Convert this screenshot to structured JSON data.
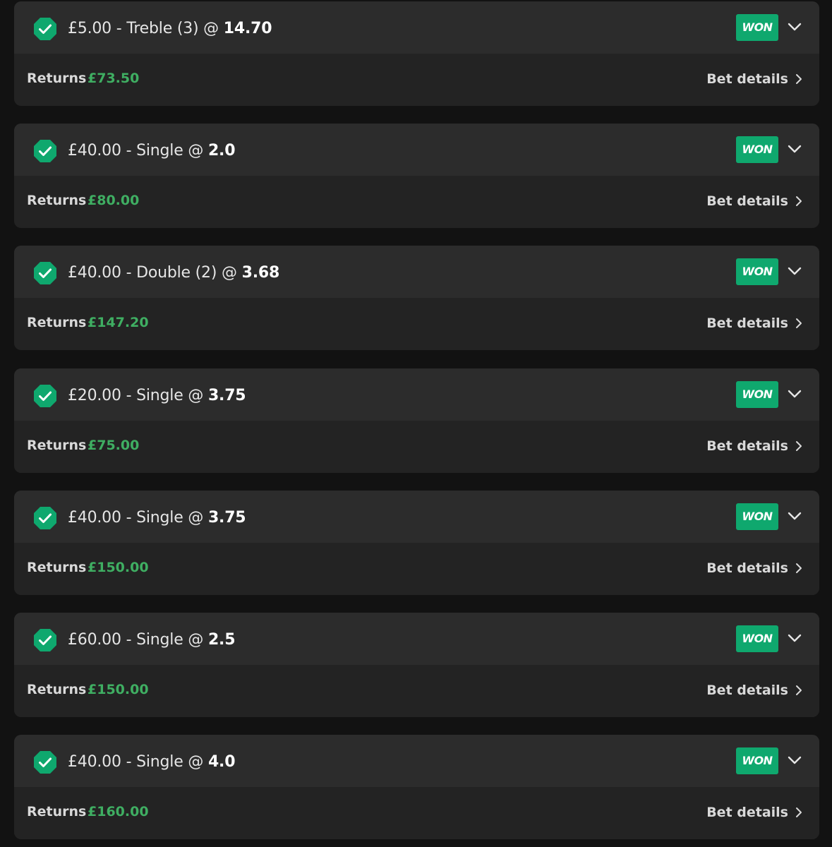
{
  "colors": {
    "page_background": "#121212",
    "card_header": "#2c2c2c",
    "card_footer": "#232323",
    "accent_green": "#0fa86e",
    "returns_green": "#3fae62"
  },
  "icons": {
    "status": "check-icon",
    "expand": "chevron-down-icon",
    "details": "chevron-right-icon"
  },
  "labels": {
    "returns": "Returns",
    "bet_details": "Bet details",
    "separator": " - ",
    "at": " @ "
  },
  "bets": [
    {
      "stake": "£5.00",
      "type": "Treble (3)",
      "odds": "14.70",
      "status": "WON",
      "returns": "£73.50"
    },
    {
      "stake": "£40.00",
      "type": "Single",
      "odds": "2.0",
      "status": "WON",
      "returns": "£80.00"
    },
    {
      "stake": "£40.00",
      "type": "Double (2)",
      "odds": "3.68",
      "status": "WON",
      "returns": "£147.20"
    },
    {
      "stake": "£20.00",
      "type": "Single",
      "odds": "3.75",
      "status": "WON",
      "returns": "£75.00"
    },
    {
      "stake": "£40.00",
      "type": "Single",
      "odds": "3.75",
      "status": "WON",
      "returns": "£150.00"
    },
    {
      "stake": "£60.00",
      "type": "Single",
      "odds": "2.5",
      "status": "WON",
      "returns": "£150.00"
    },
    {
      "stake": "£40.00",
      "type": "Single",
      "odds": "4.0",
      "status": "WON",
      "returns": "£160.00"
    }
  ]
}
